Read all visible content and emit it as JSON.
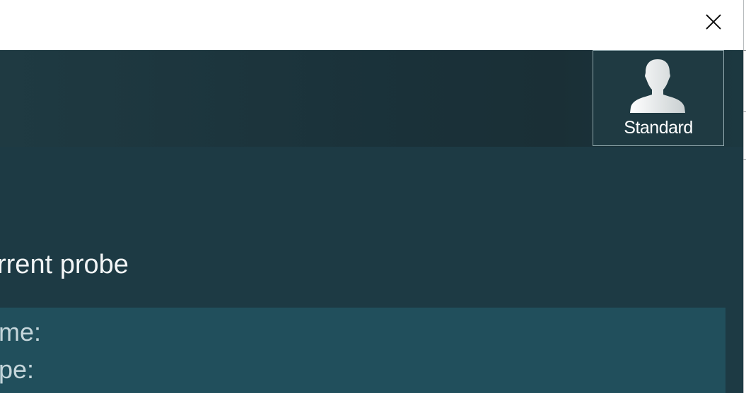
{
  "titlebar": {
    "close_icon": "close-icon"
  },
  "header": {
    "user_button": {
      "icon": "user-icon",
      "label": "Standard"
    }
  },
  "content": {
    "section_title": "rrent probe",
    "info": {
      "name_label": "me:",
      "type_label": "pe:"
    }
  }
}
